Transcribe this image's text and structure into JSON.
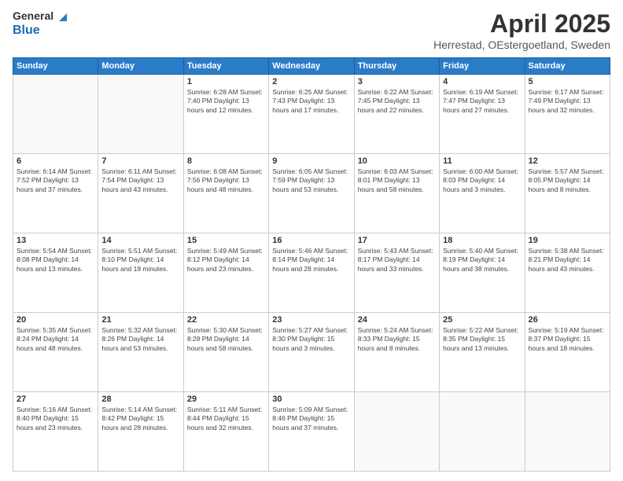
{
  "header": {
    "logo_general": "General",
    "logo_blue": "Blue",
    "title": "April 2025",
    "subtitle": "Herrestad, OEstergoetland, Sweden"
  },
  "days_of_week": [
    "Sunday",
    "Monday",
    "Tuesday",
    "Wednesday",
    "Thursday",
    "Friday",
    "Saturday"
  ],
  "weeks": [
    [
      {
        "day": "",
        "info": ""
      },
      {
        "day": "",
        "info": ""
      },
      {
        "day": "1",
        "info": "Sunrise: 6:28 AM\nSunset: 7:40 PM\nDaylight: 13 hours and 12 minutes."
      },
      {
        "day": "2",
        "info": "Sunrise: 6:25 AM\nSunset: 7:43 PM\nDaylight: 13 hours and 17 minutes."
      },
      {
        "day": "3",
        "info": "Sunrise: 6:22 AM\nSunset: 7:45 PM\nDaylight: 13 hours and 22 minutes."
      },
      {
        "day": "4",
        "info": "Sunrise: 6:19 AM\nSunset: 7:47 PM\nDaylight: 13 hours and 27 minutes."
      },
      {
        "day": "5",
        "info": "Sunrise: 6:17 AM\nSunset: 7:49 PM\nDaylight: 13 hours and 32 minutes."
      }
    ],
    [
      {
        "day": "6",
        "info": "Sunrise: 6:14 AM\nSunset: 7:52 PM\nDaylight: 13 hours and 37 minutes."
      },
      {
        "day": "7",
        "info": "Sunrise: 6:11 AM\nSunset: 7:54 PM\nDaylight: 13 hours and 43 minutes."
      },
      {
        "day": "8",
        "info": "Sunrise: 6:08 AM\nSunset: 7:56 PM\nDaylight: 13 hours and 48 minutes."
      },
      {
        "day": "9",
        "info": "Sunrise: 6:05 AM\nSunset: 7:59 PM\nDaylight: 13 hours and 53 minutes."
      },
      {
        "day": "10",
        "info": "Sunrise: 6:03 AM\nSunset: 8:01 PM\nDaylight: 13 hours and 58 minutes."
      },
      {
        "day": "11",
        "info": "Sunrise: 6:00 AM\nSunset: 8:03 PM\nDaylight: 14 hours and 3 minutes."
      },
      {
        "day": "12",
        "info": "Sunrise: 5:57 AM\nSunset: 8:05 PM\nDaylight: 14 hours and 8 minutes."
      }
    ],
    [
      {
        "day": "13",
        "info": "Sunrise: 5:54 AM\nSunset: 8:08 PM\nDaylight: 14 hours and 13 minutes."
      },
      {
        "day": "14",
        "info": "Sunrise: 5:51 AM\nSunset: 8:10 PM\nDaylight: 14 hours and 18 minutes."
      },
      {
        "day": "15",
        "info": "Sunrise: 5:49 AM\nSunset: 8:12 PM\nDaylight: 14 hours and 23 minutes."
      },
      {
        "day": "16",
        "info": "Sunrise: 5:46 AM\nSunset: 8:14 PM\nDaylight: 14 hours and 28 minutes."
      },
      {
        "day": "17",
        "info": "Sunrise: 5:43 AM\nSunset: 8:17 PM\nDaylight: 14 hours and 33 minutes."
      },
      {
        "day": "18",
        "info": "Sunrise: 5:40 AM\nSunset: 8:19 PM\nDaylight: 14 hours and 38 minutes."
      },
      {
        "day": "19",
        "info": "Sunrise: 5:38 AM\nSunset: 8:21 PM\nDaylight: 14 hours and 43 minutes."
      }
    ],
    [
      {
        "day": "20",
        "info": "Sunrise: 5:35 AM\nSunset: 8:24 PM\nDaylight: 14 hours and 48 minutes."
      },
      {
        "day": "21",
        "info": "Sunrise: 5:32 AM\nSunset: 8:26 PM\nDaylight: 14 hours and 53 minutes."
      },
      {
        "day": "22",
        "info": "Sunrise: 5:30 AM\nSunset: 8:28 PM\nDaylight: 14 hours and 58 minutes."
      },
      {
        "day": "23",
        "info": "Sunrise: 5:27 AM\nSunset: 8:30 PM\nDaylight: 15 hours and 3 minutes."
      },
      {
        "day": "24",
        "info": "Sunrise: 5:24 AM\nSunset: 8:33 PM\nDaylight: 15 hours and 8 minutes."
      },
      {
        "day": "25",
        "info": "Sunrise: 5:22 AM\nSunset: 8:35 PM\nDaylight: 15 hours and 13 minutes."
      },
      {
        "day": "26",
        "info": "Sunrise: 5:19 AM\nSunset: 8:37 PM\nDaylight: 15 hours and 18 minutes."
      }
    ],
    [
      {
        "day": "27",
        "info": "Sunrise: 5:16 AM\nSunset: 8:40 PM\nDaylight: 15 hours and 23 minutes."
      },
      {
        "day": "28",
        "info": "Sunrise: 5:14 AM\nSunset: 8:42 PM\nDaylight: 15 hours and 28 minutes."
      },
      {
        "day": "29",
        "info": "Sunrise: 5:11 AM\nSunset: 8:44 PM\nDaylight: 15 hours and 32 minutes."
      },
      {
        "day": "30",
        "info": "Sunrise: 5:09 AM\nSunset: 8:46 PM\nDaylight: 15 hours and 37 minutes."
      },
      {
        "day": "",
        "info": ""
      },
      {
        "day": "",
        "info": ""
      },
      {
        "day": "",
        "info": ""
      }
    ]
  ]
}
